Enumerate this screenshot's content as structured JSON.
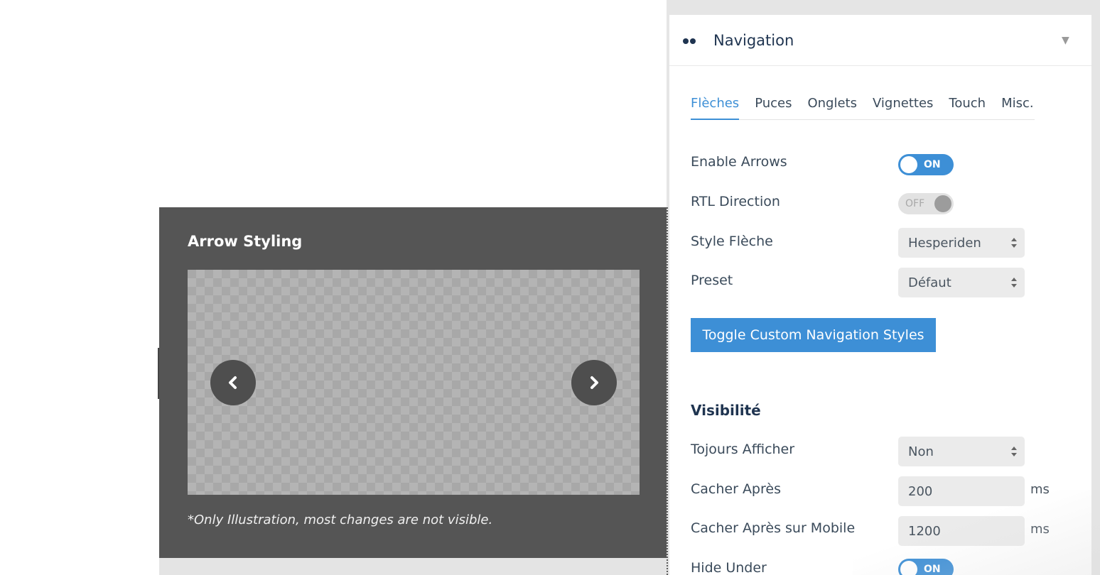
{
  "preview": {
    "title": "Arrow Styling",
    "note": "*Only Illustration, most changes are not visible."
  },
  "panel": {
    "header_title": "Navigation",
    "tabs": [
      {
        "label": "Flèches",
        "active": true
      },
      {
        "label": "Puces",
        "active": false
      },
      {
        "label": "Onglets",
        "active": false
      },
      {
        "label": "Vignettes",
        "active": false
      },
      {
        "label": "Touch",
        "active": false
      },
      {
        "label": "Misc.",
        "active": false
      }
    ],
    "enable_arrows": {
      "label": "Enable Arrows",
      "state": "ON"
    },
    "rtl_direction": {
      "label": "RTL Direction",
      "state": "OFF"
    },
    "style_fleche": {
      "label": "Style Flèche",
      "value": "Hesperiden"
    },
    "preset": {
      "label": "Preset",
      "value": "Défaut"
    },
    "custom_button": "Toggle Custom Navigation Styles",
    "visibility": {
      "title": "Visibilité",
      "toujours_afficher": {
        "label": "Tojours Afficher",
        "value": "Non"
      },
      "cacher_apres": {
        "label": "Cacher Après",
        "value": "200",
        "unit": "ms"
      },
      "cacher_apres_mobile": {
        "label": "Cacher Après sur Mobile",
        "value": "1200",
        "unit": "ms"
      },
      "hide_under": {
        "label": "Hide Under",
        "state": "ON"
      }
    }
  },
  "colors": {
    "accent": "#3d8fd6",
    "preview_bg": "#555555",
    "heading": "#1f3450"
  },
  "icons": [
    "chevron-left-icon",
    "chevron-right-icon",
    "two-dots-icon",
    "caret-down-icon",
    "select-arrows-icon"
  ]
}
